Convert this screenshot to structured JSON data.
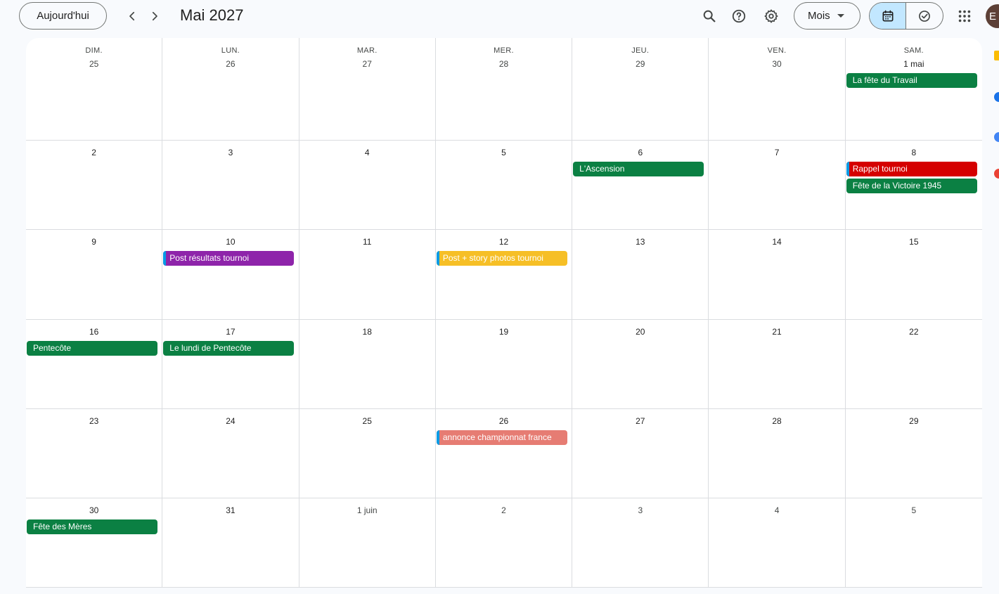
{
  "toolbar": {
    "today_label": "Aujourd'hui",
    "month_title": "Mai 2027",
    "view_label": "Mois",
    "avatar_letter": "E"
  },
  "weekdays": [
    "DIM.",
    "LUN.",
    "MAR.",
    "MER.",
    "JEU.",
    "VEN.",
    "SAM."
  ],
  "weeks": [
    [
      {
        "label": "25",
        "other": true,
        "events": []
      },
      {
        "label": "26",
        "other": true,
        "events": []
      },
      {
        "label": "27",
        "other": true,
        "events": []
      },
      {
        "label": "28",
        "other": true,
        "events": []
      },
      {
        "label": "29",
        "other": true,
        "events": []
      },
      {
        "label": "30",
        "other": true,
        "events": []
      },
      {
        "label": "1 mai",
        "other": false,
        "events": [
          {
            "title": "La fête du Travail",
            "color": "#0b8043",
            "stripe": false
          }
        ]
      }
    ],
    [
      {
        "label": "2",
        "other": false,
        "events": []
      },
      {
        "label": "3",
        "other": false,
        "events": []
      },
      {
        "label": "4",
        "other": false,
        "events": []
      },
      {
        "label": "5",
        "other": false,
        "events": []
      },
      {
        "label": "6",
        "other": false,
        "events": [
          {
            "title": "L'Ascension",
            "color": "#0b8043",
            "stripe": false
          }
        ]
      },
      {
        "label": "7",
        "other": false,
        "events": []
      },
      {
        "label": "8",
        "other": false,
        "events": [
          {
            "title": "Rappel tournoi",
            "color": "#d50000",
            "stripe": true
          },
          {
            "title": "Fête de la Victoire 1945",
            "color": "#0b8043",
            "stripe": false
          }
        ]
      }
    ],
    [
      {
        "label": "9",
        "other": false,
        "events": []
      },
      {
        "label": "10",
        "other": false,
        "events": [
          {
            "title": "Post résultats tournoi",
            "color": "#8e24aa",
            "stripe": true
          }
        ]
      },
      {
        "label": "11",
        "other": false,
        "events": []
      },
      {
        "label": "12",
        "other": false,
        "events": [
          {
            "title": "Post + story photos tournoi",
            "color": "#f6bf26",
            "stripe": true
          }
        ]
      },
      {
        "label": "13",
        "other": false,
        "events": []
      },
      {
        "label": "14",
        "other": false,
        "events": []
      },
      {
        "label": "15",
        "other": false,
        "events": []
      }
    ],
    [
      {
        "label": "16",
        "other": false,
        "events": [
          {
            "title": "Pentecôte",
            "color": "#0b8043",
            "stripe": false
          }
        ]
      },
      {
        "label": "17",
        "other": false,
        "events": [
          {
            "title": "Le lundi de Pentecôte",
            "color": "#0b8043",
            "stripe": false
          }
        ]
      },
      {
        "label": "18",
        "other": false,
        "events": []
      },
      {
        "label": "19",
        "other": false,
        "events": []
      },
      {
        "label": "20",
        "other": false,
        "events": []
      },
      {
        "label": "21",
        "other": false,
        "events": []
      },
      {
        "label": "22",
        "other": false,
        "events": []
      }
    ],
    [
      {
        "label": "23",
        "other": false,
        "events": []
      },
      {
        "label": "24",
        "other": false,
        "events": []
      },
      {
        "label": "25",
        "other": false,
        "events": []
      },
      {
        "label": "26",
        "other": false,
        "events": [
          {
            "title": "annonce championnat france",
            "color": "#e67c73",
            "stripe": true
          }
        ]
      },
      {
        "label": "27",
        "other": false,
        "events": []
      },
      {
        "label": "28",
        "other": false,
        "events": []
      },
      {
        "label": "29",
        "other": false,
        "events": []
      }
    ],
    [
      {
        "label": "30",
        "other": false,
        "events": [
          {
            "title": "Fête des Mères",
            "color": "#0b8043",
            "stripe": false
          }
        ]
      },
      {
        "label": "31",
        "other": false,
        "events": []
      },
      {
        "label": "1 juin",
        "other": true,
        "events": []
      },
      {
        "label": "2",
        "other": true,
        "events": []
      },
      {
        "label": "3",
        "other": true,
        "events": []
      },
      {
        "label": "4",
        "other": true,
        "events": []
      },
      {
        "label": "5",
        "other": true,
        "events": []
      }
    ]
  ],
  "colors": {
    "accent": "#c2e7ff",
    "holiday_green": "#0b8043",
    "stripe_blue": "#039be5"
  }
}
